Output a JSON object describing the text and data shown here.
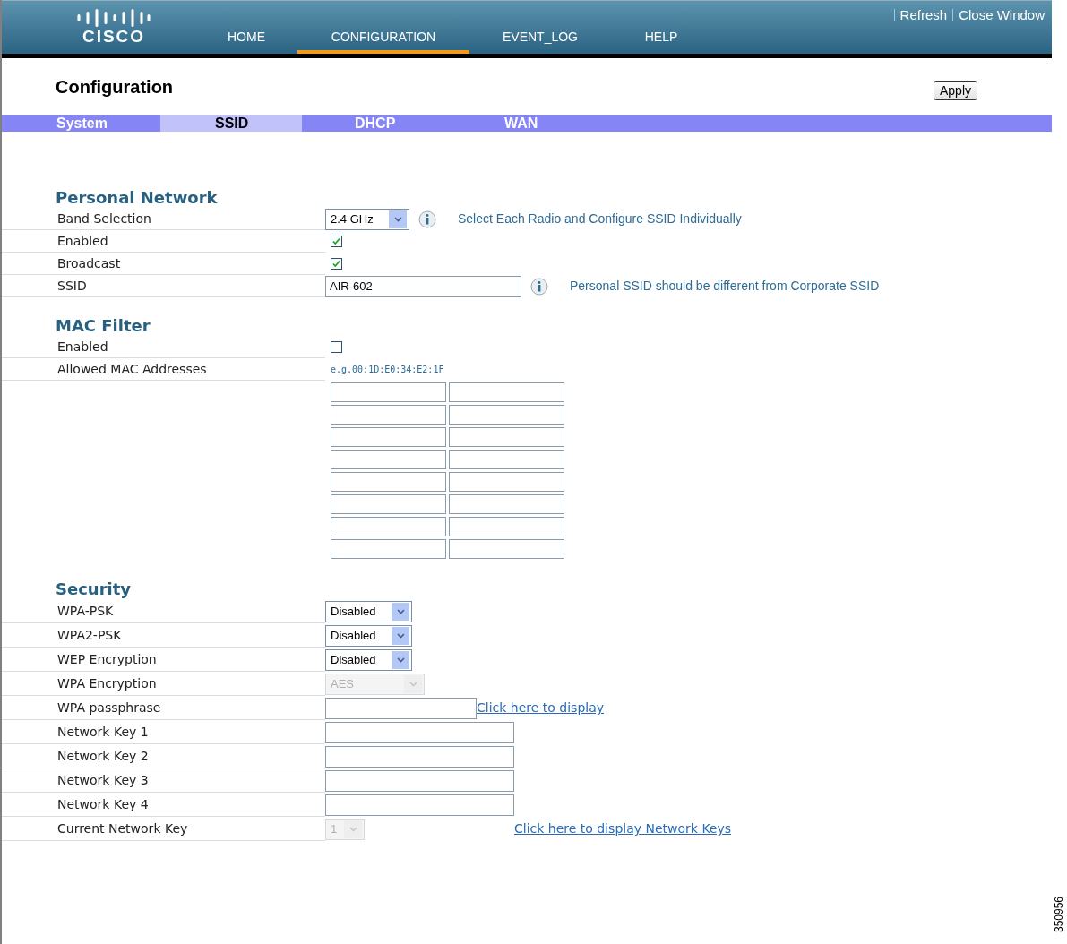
{
  "header": {
    "logo": "CISCO",
    "nav": [
      {
        "label": "HOME",
        "selected": false
      },
      {
        "label": "CONFIGURATION",
        "selected": true
      },
      {
        "label": "EVENT_LOG",
        "selected": false
      },
      {
        "label": "HELP",
        "selected": false
      }
    ],
    "links": [
      "Refresh",
      "Close Window"
    ]
  },
  "page_title": "Configuration",
  "apply_button": "Apply",
  "subtabs": [
    {
      "label": "System",
      "selected": false
    },
    {
      "label": "SSID",
      "selected": true
    },
    {
      "label": "DHCP",
      "selected": false
    },
    {
      "label": "WAN",
      "selected": false
    }
  ],
  "sections": [
    {
      "title": "Personal Network",
      "rows": [
        {
          "kind": "select",
          "label": "Band Selection",
          "value": "2.4 GHz",
          "disabled": false,
          "info": "Select Each Radio and Configure SSID Individually"
        },
        {
          "kind": "checkbox",
          "label": "Enabled",
          "checked": true
        },
        {
          "kind": "checkbox",
          "label": "Broadcast",
          "checked": true
        },
        {
          "kind": "text",
          "label": "SSID",
          "value": "AIR-602",
          "info": "Personal SSID should be different from Corporate SSID"
        }
      ]
    },
    {
      "title": "MAC Filter",
      "rows": [
        {
          "kind": "checkbox",
          "label": "Enabled",
          "checked": false
        },
        {
          "kind": "hint",
          "label": "Allowed MAC Addresses",
          "hint": "e.g.00:1D:E0:34:E2:1F"
        },
        {
          "kind": "macgrid"
        }
      ]
    },
    {
      "title": "Security",
      "rows": [
        {
          "kind": "select",
          "label": "WPA-PSK",
          "value": "Disabled",
          "disabled": false
        },
        {
          "kind": "select",
          "label": "WPA2-PSK",
          "value": "Disabled",
          "disabled": false
        },
        {
          "kind": "select",
          "label": "WEP Encryption",
          "value": "Disabled",
          "disabled": false
        },
        {
          "kind": "select",
          "label": "WPA Encryption",
          "value": "AES",
          "disabled": true
        },
        {
          "kind": "text",
          "label": "WPA passphrase",
          "link": "Click here to display"
        },
        {
          "kind": "text",
          "label": "Network Key 1"
        },
        {
          "kind": "text",
          "label": "Network Key 2"
        },
        {
          "kind": "text",
          "label": "Network Key 3"
        },
        {
          "kind": "text",
          "label": "Network Key 4"
        },
        {
          "kind": "select",
          "label": "Current Network Key",
          "value": "1",
          "disabled": true,
          "link": "Click here to display Network Keys"
        }
      ]
    }
  ],
  "figure_number": "350956"
}
